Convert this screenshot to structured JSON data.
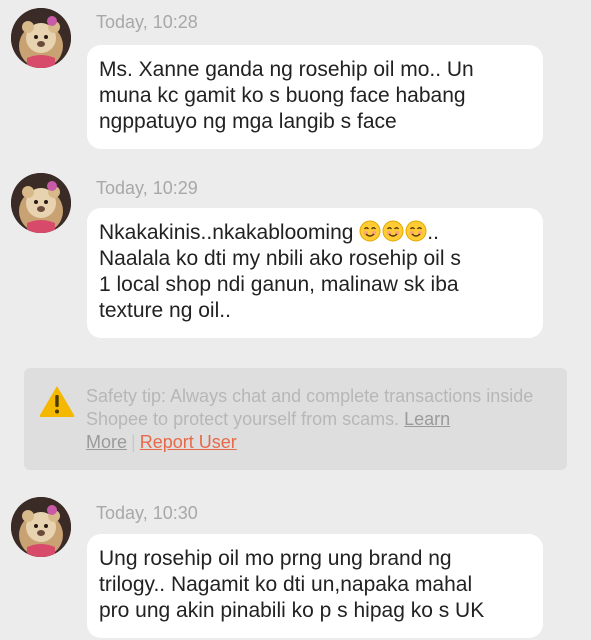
{
  "messages": [
    {
      "timestamp": "Today, 10:28",
      "lines": "Ms. Xanne ganda ng rosehip oil mo.. Un\nmuna kc gamit ko s buong face habang\nngppatuyo ng mga langib s face"
    },
    {
      "timestamp": "Today, 10:29",
      "line1_start": "Nkakakinis..nkakablooming ",
      "line1_end": "..",
      "emoji_name": "smiling-face-emoji",
      "lines_rest": "Naalala ko dti my nbili ako rosehip oil s\n1 local shop ndi ganun, malinaw sk iba\ntexture ng oil.."
    },
    {
      "timestamp": "Today, 10:30",
      "lines": "Ung rosehip oil mo prng ung brand ng\ntrilogy.. Nagamit ko dti un,napaka mahal\npro ung akin pinabili ko p s hipag ko s UK"
    }
  ],
  "safety_tip": {
    "icon": "warning-icon",
    "text": "Safety tip: Always chat and complete transactions inside Shopee to protect yourself from scams. ",
    "learn_more": "Learn More",
    "separator": "|",
    "report_user": "Report User"
  },
  "colors": {
    "background": "#ececec",
    "bubble": "#ffffff",
    "report_link": "#e66a4a",
    "warning_yellow": "#f5b800",
    "timestamp": "#a8a8a8"
  }
}
